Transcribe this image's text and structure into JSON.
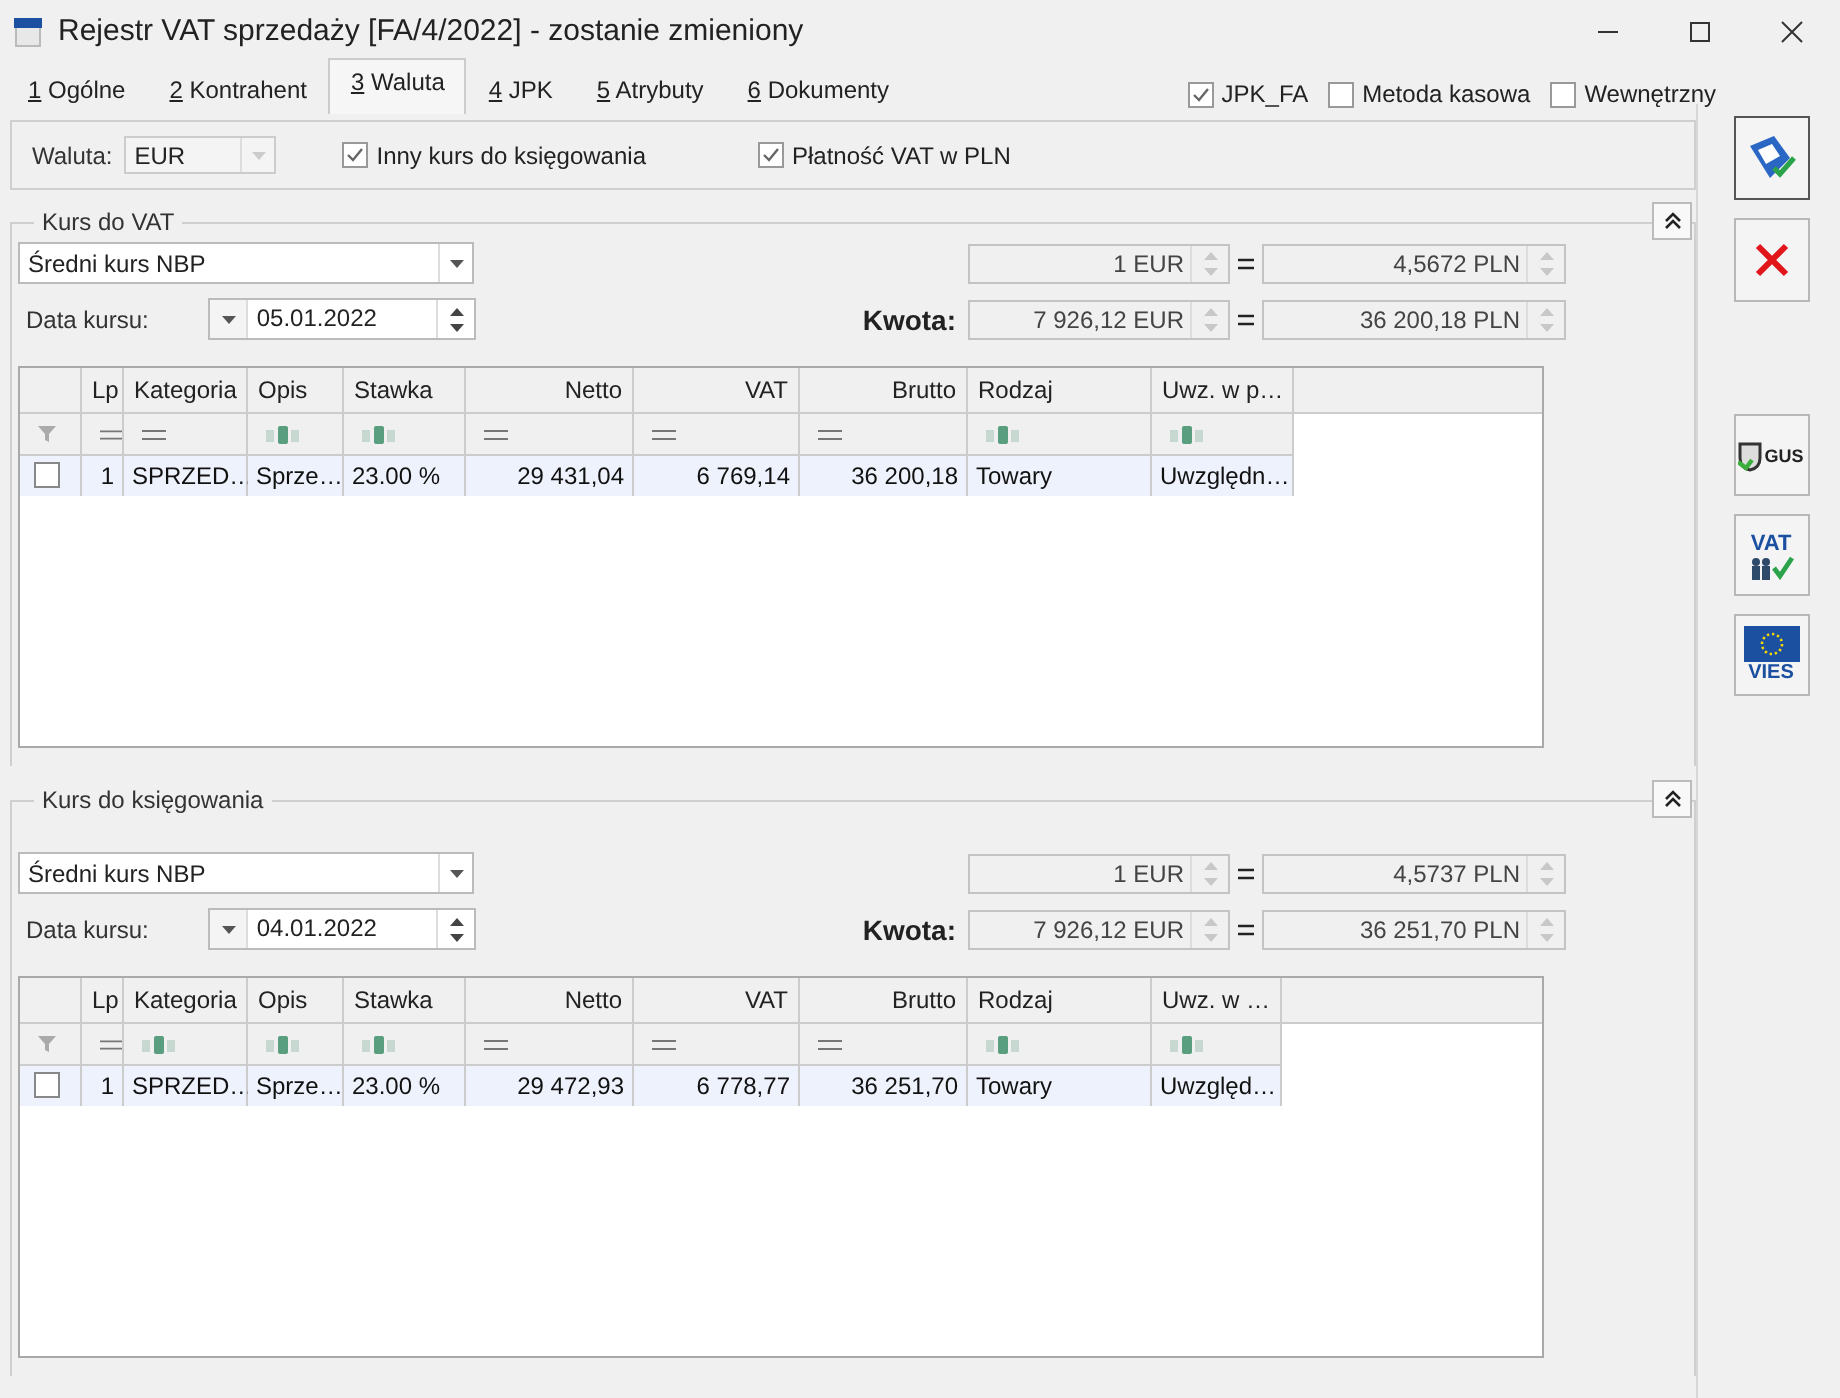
{
  "window": {
    "title": "Rejestr VAT sprzedaży [FA/4/2022] - zostanie zmieniony"
  },
  "tabs": [
    {
      "key": "1",
      "label": "Ogólne",
      "selected": false
    },
    {
      "key": "2",
      "label": "Kontrahent",
      "selected": false
    },
    {
      "key": "3",
      "label": "Waluta",
      "selected": true
    },
    {
      "key": "4",
      "label": "JPK",
      "selected": false
    },
    {
      "key": "5",
      "label": "Atrybuty",
      "selected": false
    },
    {
      "key": "6",
      "label": "Dokumenty",
      "selected": false
    }
  ],
  "flags": [
    {
      "label": "JPK_FA",
      "checked": true
    },
    {
      "label": "Metoda kasowa",
      "checked": false
    },
    {
      "label": "Wewnętrzny",
      "checked": false
    }
  ],
  "currency": {
    "label": "Waluta:",
    "value": "EUR"
  },
  "options": [
    {
      "label": "Inny kurs do księgowania",
      "checked": true
    },
    {
      "label": "Płatność VAT w PLN",
      "checked": true
    }
  ],
  "sections": [
    {
      "title": "Kurs do VAT",
      "rate_type": "Średni kurs NBP",
      "date_label": "Data kursu:",
      "date": "05.01.2022",
      "rate": [
        "1 EUR",
        "4,5672 PLN"
      ],
      "amount_label": "Kwota:",
      "amount": [
        "7 926,12 EUR",
        "36 200,18 PLN"
      ],
      "columns": [
        {
          "title": "Lp",
          "kind": "eq"
        },
        {
          "title": "Kategoria",
          "kind": "eq"
        },
        {
          "title": "Opis",
          "kind": "abc"
        },
        {
          "title": "Stawka",
          "kind": "abc"
        },
        {
          "title": "Netto",
          "kind": "eq"
        },
        {
          "title": "VAT",
          "kind": "eq"
        },
        {
          "title": "Brutto",
          "kind": "eq"
        },
        {
          "title": "Rodzaj",
          "kind": "abc"
        },
        {
          "title": "Uwz. w p…",
          "kind": "abc"
        }
      ],
      "rows": [
        {
          "checked": false,
          "cells": [
            "1",
            "SPRZED…",
            "Sprze…",
            "23.00 %",
            "29 431,04",
            "6 769,14",
            "36 200,18",
            "Towary",
            "Uwzględn…"
          ]
        }
      ]
    },
    {
      "title": "Kurs do księgowania",
      "rate_type": "Średni kurs NBP",
      "date_label": "Data kursu:",
      "date": "04.01.2022",
      "rate": [
        "1 EUR",
        "4,5737 PLN"
      ],
      "amount_label": "Kwota:",
      "amount": [
        "7 926,12 EUR",
        "36 251,70 PLN"
      ],
      "columns": [
        {
          "title": "Lp",
          "kind": "eq"
        },
        {
          "title": "Kategoria",
          "kind": "abc"
        },
        {
          "title": "Opis",
          "kind": "abc"
        },
        {
          "title": "Stawka",
          "kind": "abc"
        },
        {
          "title": "Netto",
          "kind": "eq"
        },
        {
          "title": "VAT",
          "kind": "eq"
        },
        {
          "title": "Brutto",
          "kind": "eq"
        },
        {
          "title": "Rodzaj",
          "kind": "abc"
        },
        {
          "title": "Uwz. w …",
          "kind": "abc"
        }
      ],
      "rows": [
        {
          "checked": false,
          "cells": [
            "1",
            "SPRZED…",
            "Sprze…",
            "23.00 %",
            "29 472,93",
            "6 778,77",
            "36 251,70",
            "Towary",
            "Uwzględ…"
          ]
        }
      ]
    }
  ],
  "toolbar": [
    {
      "kind": "save",
      "focused": true
    },
    {
      "kind": "cancel",
      "focused": false
    },
    {
      "kind": "gus",
      "label": "GUS",
      "focused": false
    },
    {
      "kind": "vat",
      "label": "VAT",
      "focused": false
    },
    {
      "kind": "vies",
      "label": "VIES",
      "focused": false
    }
  ]
}
